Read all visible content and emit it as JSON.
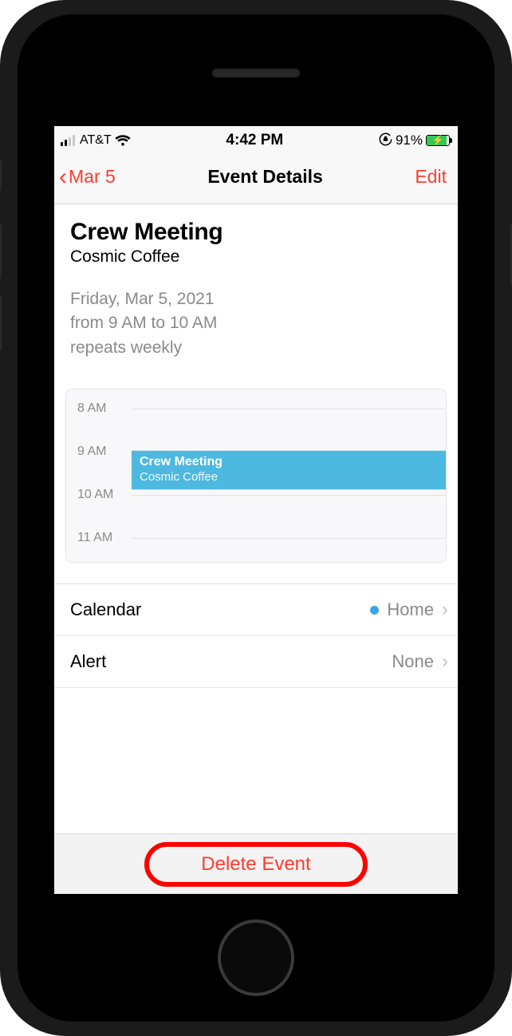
{
  "status": {
    "carrier": "AT&T",
    "time": "4:42 PM",
    "battery_pct": "91%"
  },
  "nav": {
    "back_label": "Mar 5",
    "title": "Event Details",
    "edit_label": "Edit"
  },
  "event": {
    "title": "Crew Meeting",
    "location": "Cosmic Coffee",
    "date_line": "Friday, Mar 5, 2021",
    "time_line": "from 9 AM to 10 AM",
    "repeat_line": "repeats weekly"
  },
  "timeline": {
    "hours": [
      "8 AM",
      "9 AM",
      "10 AM",
      "11 AM"
    ],
    "block_title": "Crew Meeting",
    "block_sub": "Cosmic Coffee"
  },
  "rows": {
    "calendar_label": "Calendar",
    "calendar_value": "Home",
    "alert_label": "Alert",
    "alert_value": "None"
  },
  "footer": {
    "delete_label": "Delete Event"
  }
}
